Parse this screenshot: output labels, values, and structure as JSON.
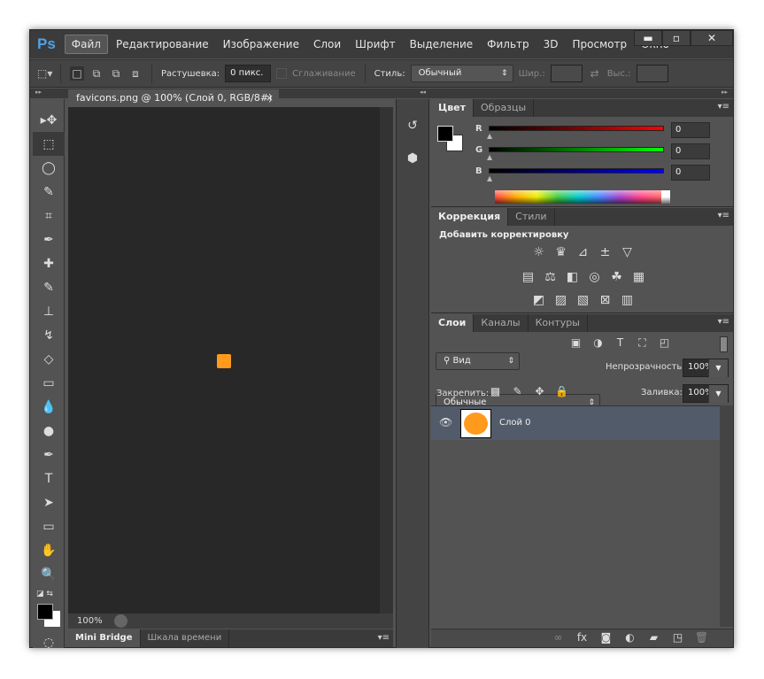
{
  "app": {
    "logo": "Ps",
    "menu": [
      "Файл",
      "Редактирование",
      "Изображение",
      "Слои",
      "Шрифт",
      "Выделение",
      "Фильтр",
      "3D",
      "Просмотр",
      "Окно"
    ],
    "window_buttons": [
      "▬",
      "▫",
      "✕"
    ]
  },
  "options": {
    "feather_label": "Растушевка:",
    "feather_value": "0 пикс.",
    "antialias_label": "Сглаживание",
    "style_label": "Стиль:",
    "style_value": "Обычный",
    "width_label": "Шир.:",
    "height_label": "Выс.:"
  },
  "document": {
    "tab_title": "favicons.png @ 100% (Слой 0, RGB/8#)",
    "close": "×",
    "zoom": "100%"
  },
  "bottom_tabs": [
    "Mini Bridge",
    "Шкала времени"
  ],
  "tools": [
    "move-tool",
    "marquee-tool",
    "lasso-tool",
    "quick-select-tool",
    "crop-tool",
    "eyedropper-tool",
    "healing-tool",
    "brush-tool",
    "stamp-tool",
    "history-brush-tool",
    "eraser-tool",
    "gradient-tool",
    "blur-tool",
    "dodge-tool",
    "pen-tool",
    "type-tool",
    "path-select-tool",
    "shape-tool",
    "hand-tool",
    "zoom-tool"
  ],
  "color_panel": {
    "tabs": [
      "Цвет",
      "Образцы"
    ],
    "channels": [
      {
        "name": "R",
        "value": "0",
        "color": "#ff0000"
      },
      {
        "name": "G",
        "value": "0",
        "color": "#00ff00"
      },
      {
        "name": "B",
        "value": "0",
        "color": "#0000ff"
      }
    ],
    "foreground": "#000000",
    "background": "#ffffff"
  },
  "adjust_panel": {
    "tabs": [
      "Коррекция",
      "Стили"
    ],
    "heading": "Добавить корректировку"
  },
  "layers_panel": {
    "tabs": [
      "Слои",
      "Каналы",
      "Контуры"
    ],
    "filter": "Вид",
    "blend": "Обычные",
    "opacity_label": "Непрозрачность:",
    "opacity": "100%",
    "lock_label": "Закрепить:",
    "fill_label": "Заливка:",
    "fill": "100%",
    "layers": [
      {
        "name": "Слой 0",
        "visible": true,
        "selected": true
      }
    ]
  }
}
